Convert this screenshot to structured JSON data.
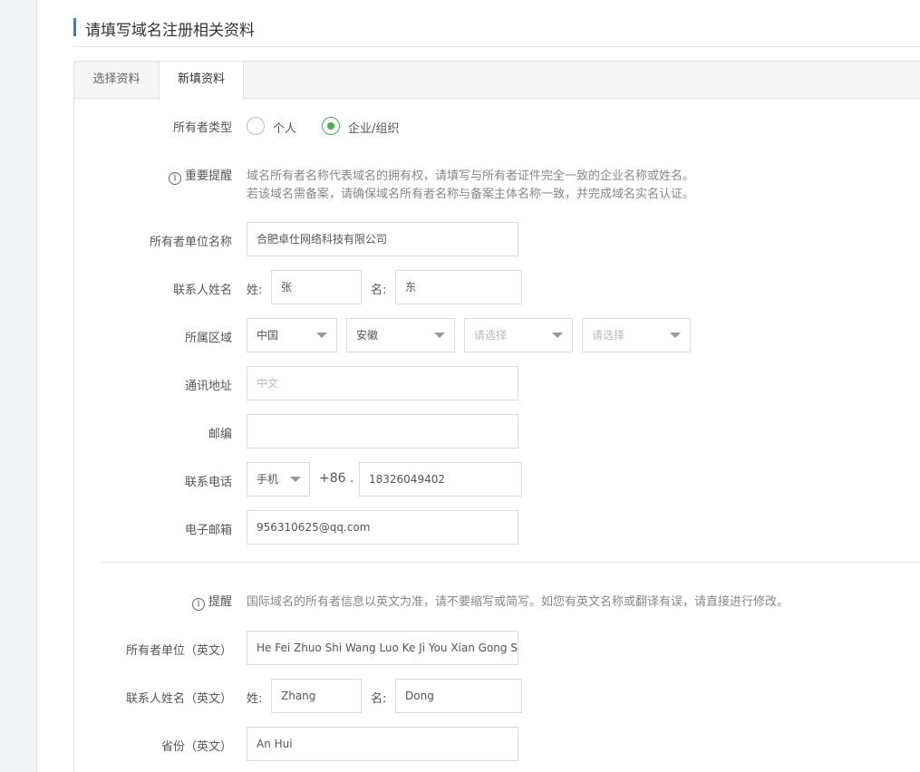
{
  "header": {
    "title": "请填写域名注册相关资料"
  },
  "tabs": [
    {
      "label": "选择资料"
    },
    {
      "label": "新填资料"
    }
  ],
  "form": {
    "owner_type": {
      "label": "所有者类型",
      "options": [
        "个人",
        "企业/组织"
      ],
      "selected": "企业/组织"
    },
    "important_notice": {
      "label": "重要提醒",
      "line1": "域名所有者名称代表域名的拥有权，请填写与所有者证件完全一致的企业名称或姓名。",
      "line2": "若该域名需备案，请确保域名所有者名称与备案主体名称一致，并完成域名实名认证。"
    },
    "org_name": {
      "label": "所有者单位名称",
      "value": "合肥卓仕网络科技有限公司"
    },
    "contact_name": {
      "label": "联系人姓名",
      "surname_label": "姓:",
      "surname": "张",
      "given_label": "名:",
      "given": "东"
    },
    "region": {
      "label": "所属区域",
      "country": "中国",
      "province": "安徽",
      "city_placeholder": "请选择",
      "district_placeholder": "请选择"
    },
    "address": {
      "label": "通讯地址",
      "placeholder": "中文",
      "value": ""
    },
    "postcode": {
      "label": "邮编",
      "value": ""
    },
    "phone": {
      "label": "联系电话",
      "type": "手机",
      "prefix": "+86 .",
      "value": "18326049402"
    },
    "email": {
      "label": "电子邮箱",
      "value": "956310625@qq.com"
    },
    "en_notice": {
      "label": "提醒",
      "text": "国际域名的所有者信息以英文为准，请不要缩写或简写。如您有英文名称或翻译有误，请直接进行修改。"
    },
    "org_name_en": {
      "label": "所有者单位（英文）",
      "value": "He Fei Zhuo Shi Wang Luo Ke Ji You Xian Gong Si"
    },
    "contact_name_en": {
      "label": "联系人姓名（英文）",
      "surname_label": "姓:",
      "surname": "Zhang",
      "given_label": "名:",
      "given": "Dong"
    },
    "province_en": {
      "label": "省份（英文）",
      "value": "An Hui"
    }
  },
  "colors": {
    "accent": "#2a7fdc",
    "radio_selected": "#4caf50"
  }
}
